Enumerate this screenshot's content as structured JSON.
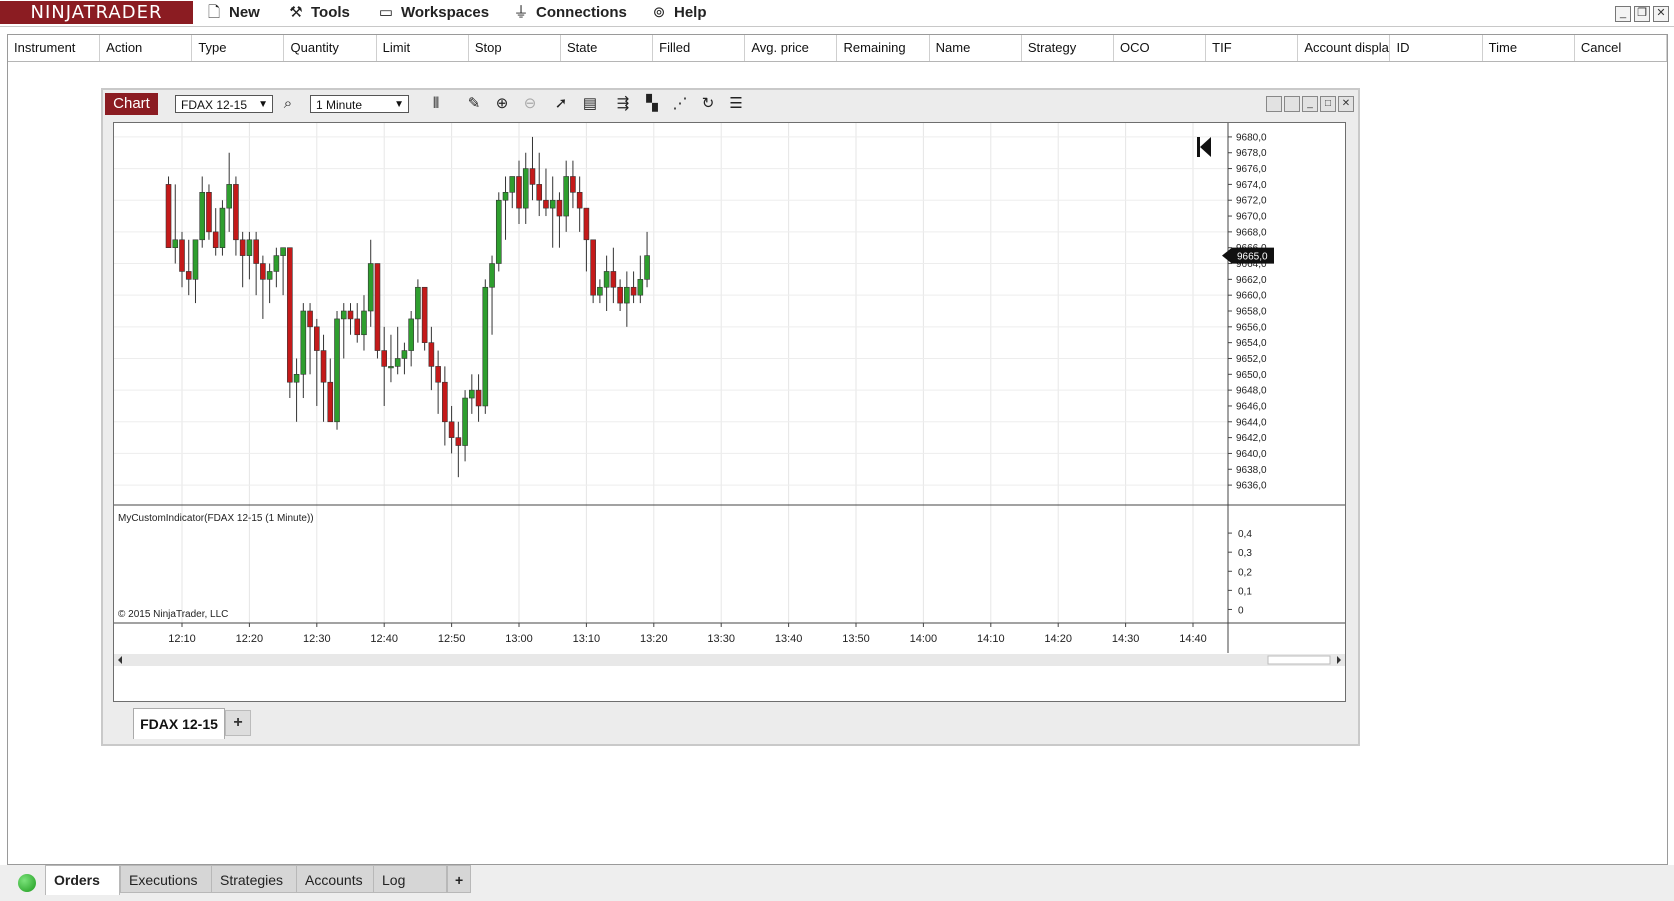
{
  "app": {
    "logo": "NINJATRADER",
    "menu": [
      {
        "label": "New",
        "icon": "new-document-icon"
      },
      {
        "label": "Tools",
        "icon": "wrench-icon"
      },
      {
        "label": "Workspaces",
        "icon": "workspace-icon"
      },
      {
        "label": "Connections",
        "icon": "plug-icon"
      },
      {
        "label": "Help",
        "icon": "lifebuoy-icon"
      }
    ]
  },
  "orders_grid": {
    "columns": [
      "Instrument",
      "Action",
      "Type",
      "Quantity",
      "Limit",
      "Stop",
      "State",
      "Filled",
      "Avg. price",
      "Remaining",
      "Name",
      "Strategy",
      "OCO",
      "TIF",
      "Account displa",
      "ID",
      "Time",
      "Cancel"
    ]
  },
  "chart_window": {
    "tab_label": "Chart",
    "instrument": "FDAX 12-15",
    "interval": "1 Minute",
    "indicator_label": "MyCustomIndicator(FDAX 12-15 (1 Minute))",
    "copyright": "© 2015 NinjaTrader, LLC",
    "sheet_tab": "FDAX 12-15",
    "add_tab": "+",
    "last_price": "9665,0"
  },
  "bottom_tabs": {
    "items": [
      "Orders",
      "Executions",
      "Strategies",
      "Accounts",
      "Log"
    ],
    "active": "Orders",
    "add": "+"
  },
  "colors": {
    "brand": "#8b1c22",
    "up_candle": "#2e9e2e",
    "down_candle": "#c41a1a"
  },
  "chart_data": {
    "type": "candlestick",
    "price_axis": {
      "ylim": [
        9635,
        9681
      ],
      "ticks": [
        "9680,0",
        "9678,0",
        "9676,0",
        "9674,0",
        "9672,0",
        "9670,0",
        "9668,0",
        "9666,0",
        "9664,0",
        "9662,0",
        "9660,0",
        "9658,0",
        "9656,0",
        "9654,0",
        "9652,0",
        "9650,0",
        "9648,0",
        "9646,0",
        "9644,0",
        "9642,0",
        "9640,0",
        "9638,0",
        "9636,0"
      ]
    },
    "indicator_axis": {
      "ylim": [
        -0.05,
        0.5
      ],
      "ticks": [
        "0,4",
        "0,3",
        "0,2",
        "0,1",
        "0"
      ]
    },
    "time_axis": {
      "ticks": [
        "12:10",
        "12:20",
        "12:30",
        "12:40",
        "12:50",
        "13:00",
        "13:10",
        "13:20",
        "13:30",
        "13:40",
        "13:50",
        "14:00",
        "14:10",
        "14:20",
        "14:30",
        "14:40"
      ]
    },
    "bar_interval_minutes": 1,
    "first_bar_time": "12:08",
    "candles": [
      [
        9674,
        9675,
        9666,
        9666
      ],
      [
        9666,
        9674,
        9664,
        9667
      ],
      [
        9667,
        9668,
        9661,
        9663
      ],
      [
        9663,
        9667,
        9660,
        9662
      ],
      [
        9662,
        9667,
        9659,
        9667
      ],
      [
        9667,
        9675,
        9666,
        9673
      ],
      [
        9673,
        9674,
        9667,
        9668
      ],
      [
        9668,
        9671,
        9665,
        9666
      ],
      [
        9666,
        9672,
        9665,
        9671
      ],
      [
        9671,
        9678,
        9668,
        9674
      ],
      [
        9674,
        9675,
        9665,
        9667
      ],
      [
        9667,
        9668,
        9661,
        9665
      ],
      [
        9665,
        9668,
        9662,
        9667
      ],
      [
        9667,
        9668,
        9660,
        9664
      ],
      [
        9664,
        9665,
        9657,
        9662
      ],
      [
        9662,
        9664,
        9659,
        9663
      ],
      [
        9663,
        9666,
        9661,
        9665
      ],
      [
        9665,
        9666,
        9660,
        9666
      ],
      [
        9666,
        9666,
        9647,
        9649
      ],
      [
        9649,
        9652,
        9644,
        9650
      ],
      [
        9650,
        9659,
        9647,
        9658
      ],
      [
        9658,
        9659,
        9650,
        9656
      ],
      [
        9656,
        9657,
        9646,
        9653
      ],
      [
        9653,
        9655,
        9644,
        9649
      ],
      [
        9649,
        9652,
        9644,
        9644
      ],
      [
        9644,
        9658,
        9643,
        9657
      ],
      [
        9657,
        9659,
        9652,
        9658
      ],
      [
        9658,
        9659,
        9655,
        9657
      ],
      [
        9657,
        9659,
        9654,
        9655
      ],
      [
        9655,
        9660,
        9653,
        9658
      ],
      [
        9658,
        9667,
        9656,
        9664
      ],
      [
        9664,
        9664,
        9652,
        9653
      ],
      [
        9653,
        9656,
        9646,
        9651
      ],
      [
        9651,
        9655,
        9649,
        9651
      ],
      [
        9651,
        9656,
        9650,
        9652
      ],
      [
        9652,
        9654,
        9650,
        9653
      ],
      [
        9653,
        9658,
        9651,
        9657
      ],
      [
        9657,
        9662,
        9654,
        9661
      ],
      [
        9661,
        9661,
        9653,
        9654
      ],
      [
        9654,
        9656,
        9648,
        9651
      ],
      [
        9651,
        9653,
        9645,
        9649
      ],
      [
        9649,
        9651,
        9641,
        9644
      ],
      [
        9644,
        9646,
        9640,
        9642
      ],
      [
        9642,
        9644,
        9637,
        9641
      ],
      [
        9641,
        9648,
        9639,
        9647
      ],
      [
        9647,
        9650,
        9645,
        9648
      ],
      [
        9648,
        9650,
        9644,
        9646
      ],
      [
        9646,
        9662,
        9645,
        9661
      ],
      [
        9661,
        9665,
        9655,
        9664
      ],
      [
        9664,
        9673,
        9663,
        9672
      ],
      [
        9672,
        9675,
        9667,
        9673
      ],
      [
        9673,
        9675,
        9671,
        9675
      ],
      [
        9675,
        9677,
        9669,
        9671
      ],
      [
        9671,
        9678,
        9669,
        9676
      ],
      [
        9676,
        9680,
        9672,
        9674
      ],
      [
        9674,
        9678,
        9670,
        9672
      ],
      [
        9672,
        9676,
        9670,
        9671
      ],
      [
        9671,
        9675,
        9666,
        9672
      ],
      [
        9672,
        9673,
        9666,
        9670
      ],
      [
        9670,
        9677,
        9668,
        9675
      ],
      [
        9675,
        9677,
        9671,
        9673
      ],
      [
        9673,
        9675,
        9668,
        9671
      ],
      [
        9671,
        9671,
        9663,
        9667
      ],
      [
        9667,
        9667,
        9659,
        9660
      ],
      [
        9660,
        9662,
        9659,
        9661
      ],
      [
        9661,
        9665,
        9658,
        9663
      ],
      [
        9663,
        9666,
        9659,
        9661
      ],
      [
        9661,
        9662,
        9658,
        9659
      ],
      [
        9659,
        9663,
        9656,
        9661
      ],
      [
        9661,
        9663,
        9659,
        9660
      ],
      [
        9660,
        9665,
        9659,
        9662
      ],
      [
        9662,
        9668,
        9661,
        9665
      ]
    ]
  }
}
